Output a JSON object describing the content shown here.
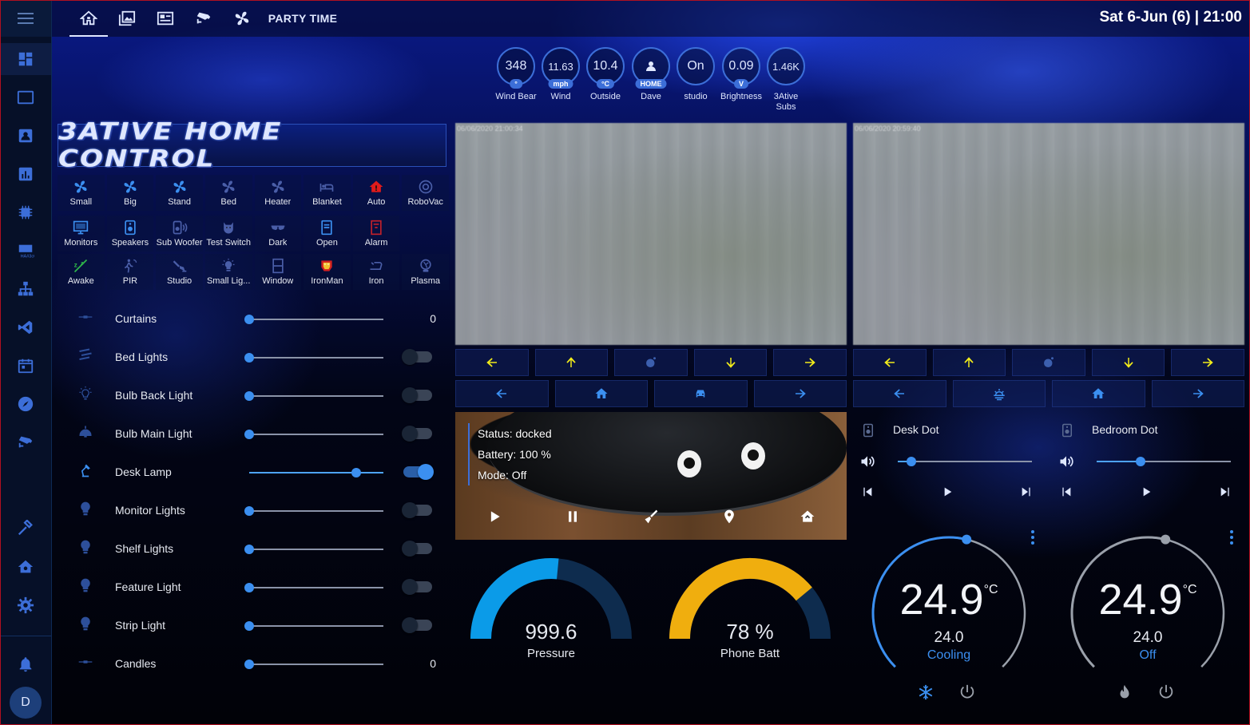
{
  "header": {
    "clock": "Sat 6-Jun (6) | 21:00",
    "tabs": [
      {
        "icon": "home-icon"
      },
      {
        "icon": "image-gallery-icon"
      },
      {
        "icon": "newspaper-icon"
      },
      {
        "icon": "cctv-icon"
      },
      {
        "icon": "fan-icon"
      },
      {
        "label": "PARTY TIME"
      }
    ]
  },
  "sidebar": {
    "items": [
      "overview-icon",
      "tablet-icon",
      "account-box-icon",
      "chart-icon",
      "chip-icon",
      "hacs-icon",
      "network-icon",
      "code-icon",
      "calendar-icon",
      "compass-icon",
      "cctv-icon",
      "hammer-icon",
      "home-settings-icon",
      "gear-icon"
    ],
    "notifications_icon": "bell-icon",
    "user_initial": "D"
  },
  "badges": [
    {
      "value": "348",
      "unit": "°",
      "label": "Wind Bear"
    },
    {
      "value": "11.63",
      "unit": "mph",
      "label": "Wind"
    },
    {
      "value": "10.4",
      "unit": "°C",
      "label": "Outside"
    },
    {
      "value": "",
      "unit": "HOME",
      "label": "Dave",
      "icon": "person-icon"
    },
    {
      "value": "On",
      "unit": "",
      "label": "studio"
    },
    {
      "value": "0.09",
      "unit": "V",
      "label": "Brightness"
    },
    {
      "value": "1.46K",
      "unit": "",
      "label": "3Ative Subs"
    }
  ],
  "banner": {
    "text": "3ATIVE HOME CONTROL"
  },
  "buttons": [
    {
      "label": "Small",
      "icon": "fan-icon",
      "color": "#3b8ff0"
    },
    {
      "label": "Big",
      "icon": "fan-icon",
      "color": "#3b8ff0"
    },
    {
      "label": "Stand",
      "icon": "fan-icon",
      "color": "#3b8ff0"
    },
    {
      "label": "Bed",
      "icon": "fan-icon",
      "color": "#4a5ea8"
    },
    {
      "label": "Heater",
      "icon": "fan-icon",
      "color": "#4a5ea8"
    },
    {
      "label": "Blanket",
      "icon": "bed-icon",
      "color": "#4a5ea8"
    },
    {
      "label": "Auto",
      "icon": "home-alert-icon",
      "color": "#e01b1b"
    },
    {
      "label": "RoboVac",
      "icon": "robot-vacuum-icon",
      "color": "#4a5ea8"
    },
    {
      "label": "Monitors",
      "icon": "monitor-icon",
      "color": "#3b8ff0"
    },
    {
      "label": "Speakers",
      "icon": "speaker-icon",
      "color": "#3b8ff0"
    },
    {
      "label": "Sub Woofer",
      "icon": "speaker-wireless-icon",
      "color": "#4a5ea8"
    },
    {
      "label": "Test Switch",
      "icon": "cat-icon",
      "color": "#4a5ea8"
    },
    {
      "label": "Dark",
      "icon": "sunglasses-icon",
      "color": "#4a5ea8"
    },
    {
      "label": "Open",
      "icon": "door-open-icon",
      "color": "#3b8ff0"
    },
    {
      "label": "Alarm",
      "icon": "alarm-panel-icon",
      "color": "#c0202a"
    },
    {
      "label": "Awake",
      "icon": "sleep-off-icon",
      "color": "#2fb84a"
    },
    {
      "label": "PIR",
      "icon": "motion-sensor-icon",
      "color": "#4a5ea8"
    },
    {
      "label": "Studio",
      "icon": "spotlight-icon",
      "color": "#4a5ea8"
    },
    {
      "label": "Small Lig...",
      "icon": "lightbulb-on-icon",
      "color": "#4a5ea8"
    },
    {
      "label": "Window",
      "icon": "window-icon",
      "color": "#4a5ea8"
    },
    {
      "label": "IronMan",
      "icon": "ironman-icon",
      "color": "#e0a020"
    },
    {
      "label": "Iron",
      "icon": "iron-icon",
      "color": "#4a5ea8"
    },
    {
      "label": "Plasma",
      "icon": "plasma-ball-icon",
      "color": "#4a5ea8"
    }
  ],
  "lights": [
    {
      "name": "Curtains",
      "icon": "curtains-icon",
      "level": 0,
      "value": "0",
      "toggle": null
    },
    {
      "name": "Bed Lights",
      "icon": "led-strip-icon",
      "level": 0,
      "toggle": false
    },
    {
      "name": "Bulb Back Light",
      "icon": "lightbulb-outline-icon",
      "level": 0,
      "toggle": false
    },
    {
      "name": "Bulb Main Light",
      "icon": "ceiling-light-icon",
      "level": 0,
      "toggle": false
    },
    {
      "name": "Desk Lamp",
      "icon": "desk-lamp-icon",
      "level": 0.8,
      "toggle": true
    },
    {
      "name": "Monitor Lights",
      "icon": "lightbulb-icon",
      "level": 0,
      "toggle": false
    },
    {
      "name": "Shelf Lights",
      "icon": "lightbulb-icon",
      "level": 0,
      "toggle": false
    },
    {
      "name": "Feature Light",
      "icon": "lightbulb-icon",
      "level": 0,
      "toggle": false
    },
    {
      "name": "Strip Light",
      "icon": "lightbulb-icon",
      "level": 0,
      "toggle": false
    },
    {
      "name": "Candles",
      "icon": "candles-icon",
      "level": 0,
      "value": "0",
      "toggle": null
    }
  ],
  "cameras": [
    {
      "timestamp": "06/06/2020 21:00:34"
    },
    {
      "timestamp": "06/06/2020 20:59:40"
    }
  ],
  "camera_controls": {
    "cam1_row1": [
      "arrow-left-icon",
      "arrow-up-icon",
      "orbit-icon",
      "arrow-down-icon",
      "arrow-right-icon"
    ],
    "cam1_row2": [
      "arrow-left-icon",
      "home-icon",
      "car-icon",
      "arrow-right-icon"
    ],
    "cam2_row1": [
      "arrow-left-icon",
      "arrow-up-icon",
      "orbit-icon",
      "arrow-down-icon",
      "arrow-right-icon"
    ],
    "cam2_row2": [
      "arrow-left-icon",
      "weather-sunset-icon",
      "home-icon",
      "arrow-right-icon"
    ]
  },
  "vacuum": {
    "status": "Status: docked",
    "battery": "Battery: 100 %",
    "mode": "Mode: Off",
    "actions": [
      "play-icon",
      "pause-icon",
      "broom-icon",
      "locate-icon",
      "home-return-icon"
    ]
  },
  "gauges": [
    {
      "value": "999.6",
      "name": "Pressure",
      "fraction": 0.53,
      "color": "#0b9be8",
      "track": "#0e2c4e"
    },
    {
      "value": "78 %",
      "name": "Phone Batt",
      "fraction": 0.78,
      "color": "#f0ae0e",
      "track": "#0e2c4e"
    }
  ],
  "media": [
    {
      "name": "Desk Dot",
      "volume": 0.1
    },
    {
      "name": "Bedroom Dot",
      "volume": 0.33
    }
  ],
  "thermostats": [
    {
      "current": "24.9",
      "unit": "°C",
      "target": "24.0",
      "mode": "Cooling",
      "mode_color": "#3b8ff0",
      "arc_color": "#3b8ff0",
      "level": 0.55,
      "buttons": [
        "snowflake-icon",
        "power-icon"
      ]
    },
    {
      "current": "24.9",
      "unit": "°C",
      "target": "24.0",
      "mode": "Off",
      "mode_color": "#3b8ff0",
      "arc_color": "#9aa0aa",
      "level": 0.55,
      "buttons": [
        "fire-icon",
        "power-icon"
      ]
    }
  ]
}
